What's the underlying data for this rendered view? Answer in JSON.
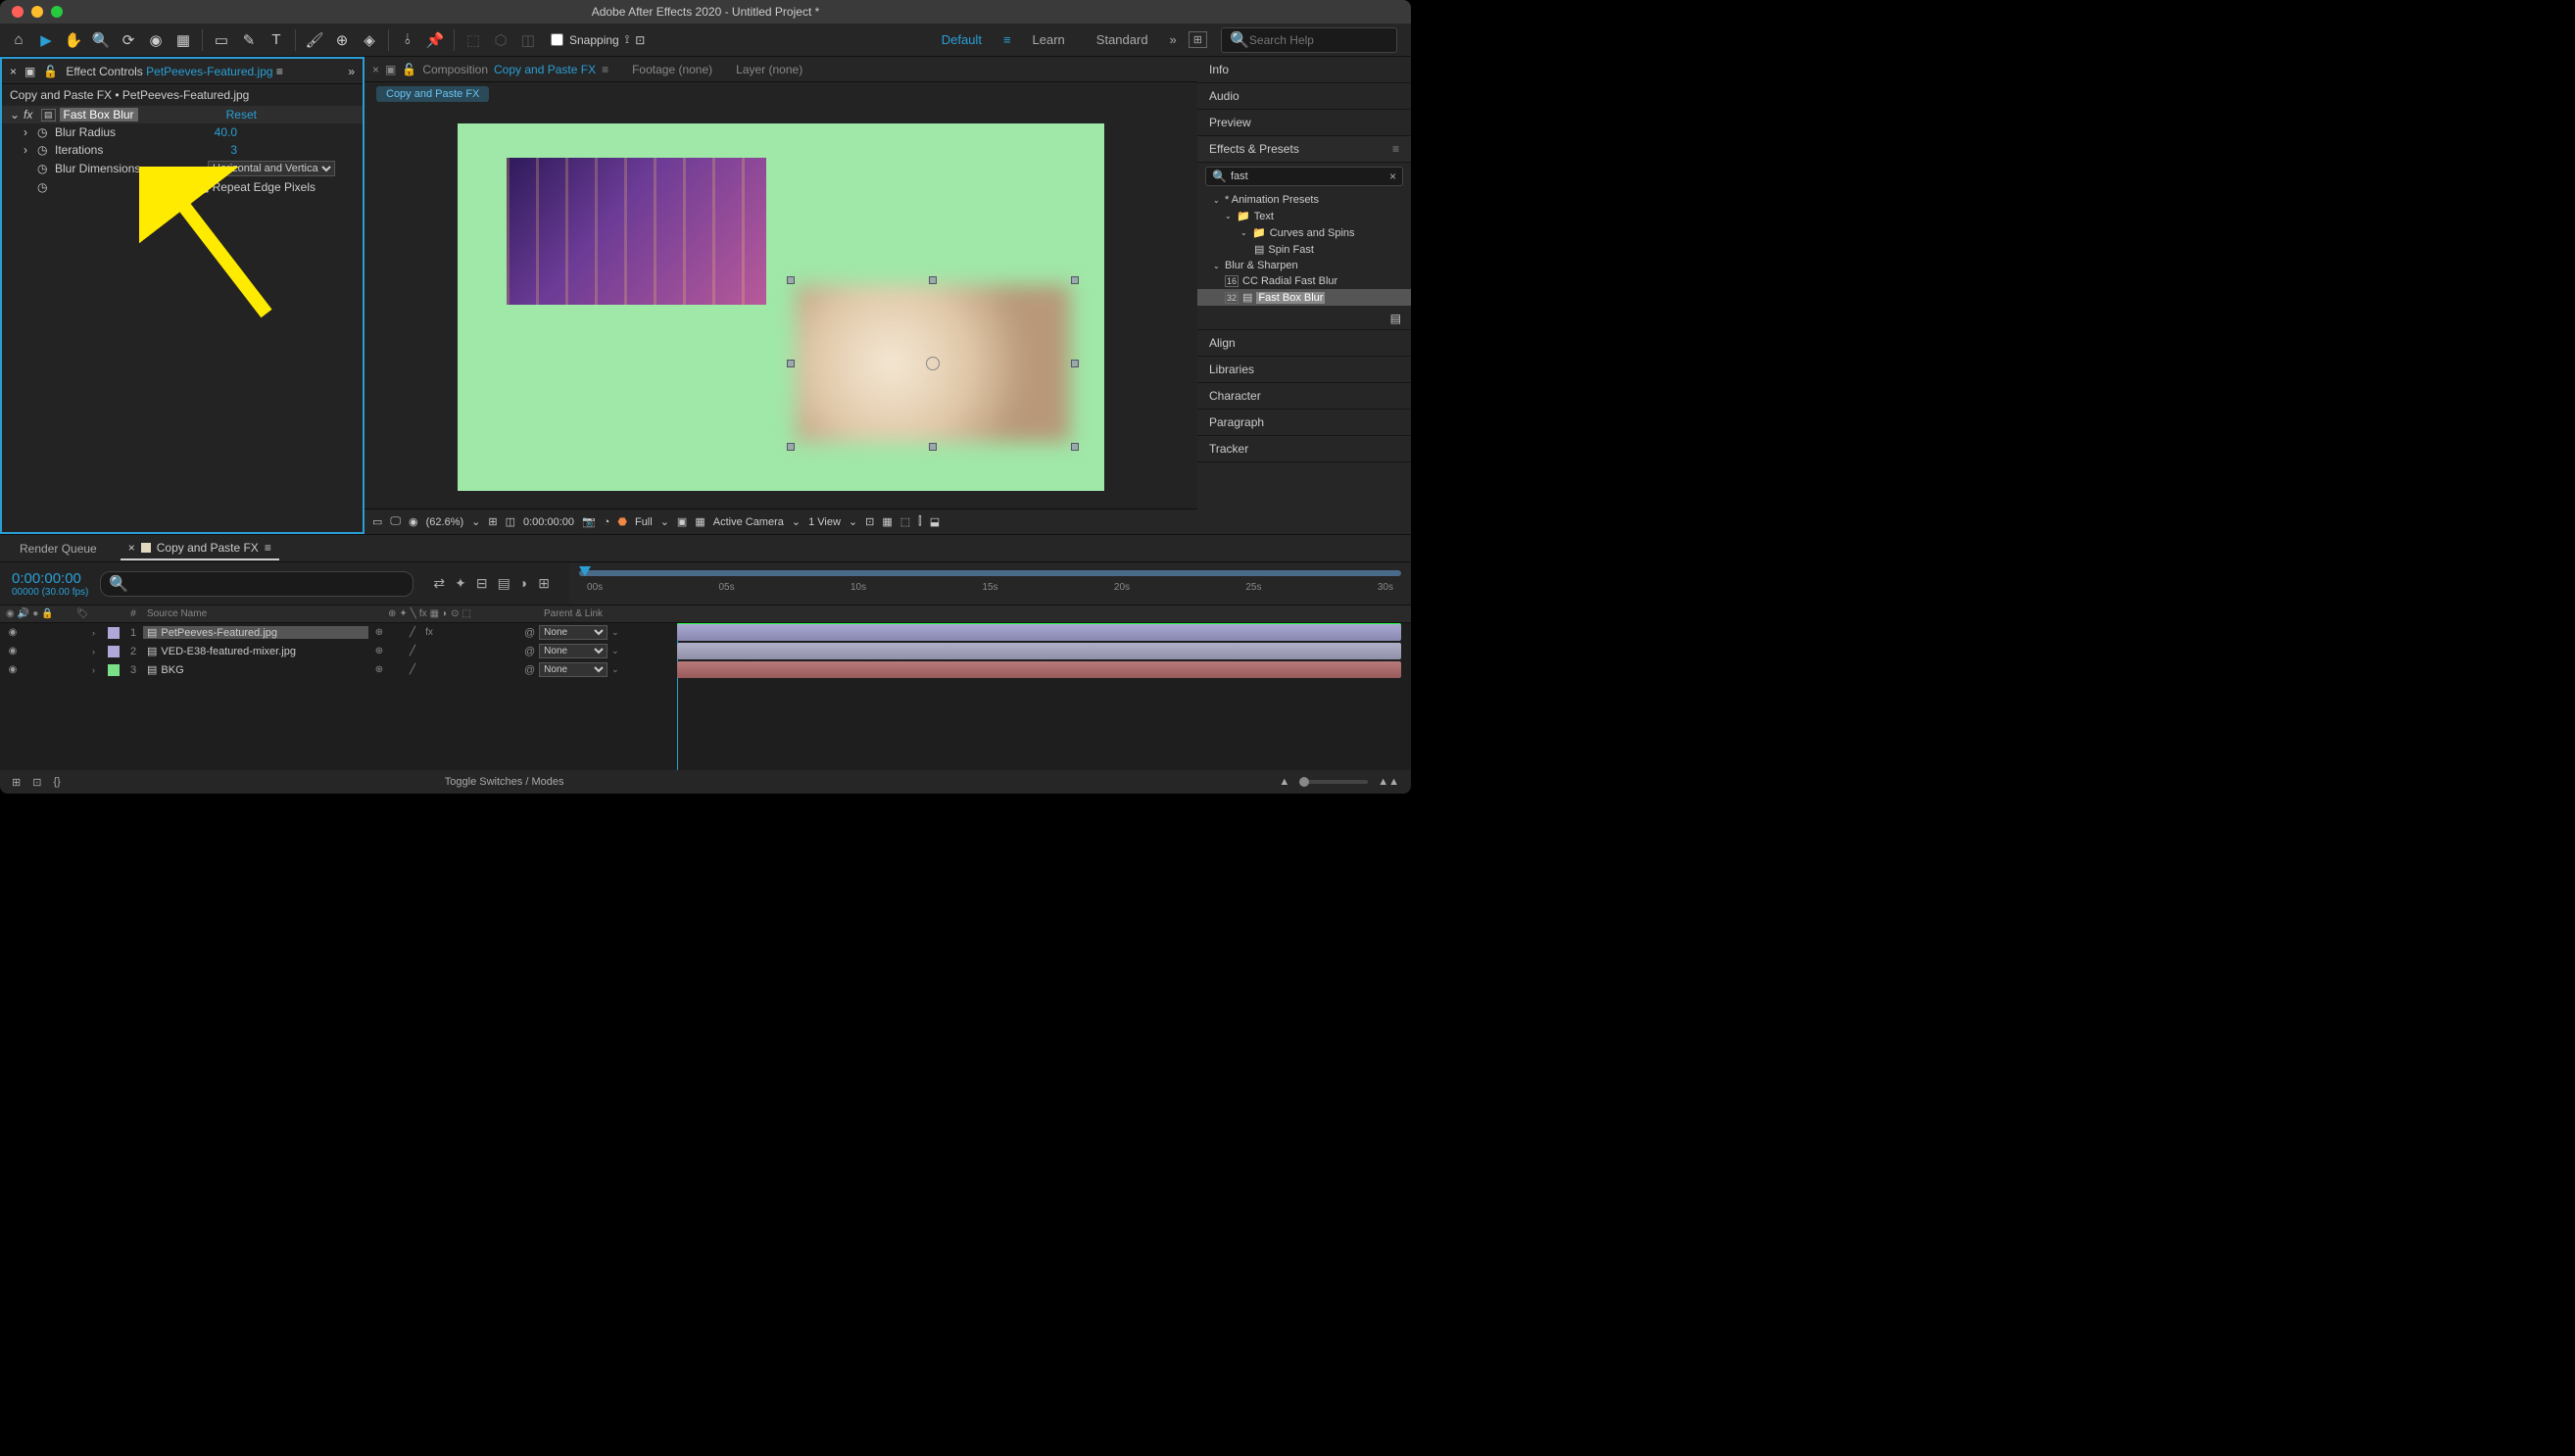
{
  "window": {
    "title": "Adobe After Effects 2020 - Untitled Project *"
  },
  "toolbar": {
    "snapping_label": "Snapping",
    "workspaces": {
      "default": "Default",
      "learn": "Learn",
      "standard": "Standard"
    },
    "search_placeholder": "Search Help"
  },
  "effect_controls": {
    "panel_title_prefix": "Effect Controls ",
    "panel_title_link": "PetPeeves-Featured.jpg",
    "breadcrumb": "Copy and Paste FX • PetPeeves-Featured.jpg",
    "effect_name": "Fast Box Blur",
    "reset_label": "Reset",
    "props": {
      "blur_radius_label": "Blur Radius",
      "blur_radius_value": "40.0",
      "iterations_label": "Iterations",
      "iterations_value": "3",
      "blur_dimensions_label": "Blur Dimensions",
      "blur_dimensions_value": "Horizontal and Vertical",
      "repeat_edge_label": "Repeat Edge Pixels"
    }
  },
  "composition": {
    "panel_prefix": "Composition ",
    "panel_link": "Copy and Paste FX",
    "footage_tab": "Footage (none)",
    "layer_tab": "Layer (none)",
    "subtab": "Copy and Paste FX",
    "controls": {
      "magnification": "(62.6%)",
      "timecode": "0:00:00:00",
      "resolution": "Full",
      "camera": "Active Camera",
      "views": "1 View"
    }
  },
  "right_panel": {
    "info": "Info",
    "audio": "Audio",
    "preview": "Preview",
    "effects_presets": "Effects & Presets",
    "search_value": "fast",
    "tree": {
      "animation_presets": "* Animation Presets",
      "text": "Text",
      "curves_spins": "Curves and Spins",
      "spin_fast": "Spin Fast",
      "blur_sharpen": "Blur & Sharpen",
      "cc_radial": "CC Radial Fast Blur",
      "fast_box_blur": "Fast Box Blur"
    },
    "align": "Align",
    "libraries": "Libraries",
    "character": "Character",
    "paragraph": "Paragraph",
    "tracker": "Tracker"
  },
  "timeline": {
    "render_queue": "Render Queue",
    "comp_tab": "Copy and Paste FX",
    "timecode": "0:00:00:00",
    "timecode_sub": "00000 (30.00 fps)",
    "ruler": [
      "00s",
      "05s",
      "10s",
      "15s",
      "20s",
      "25s",
      "30s"
    ],
    "cols": {
      "num": "#",
      "source": "Source Name",
      "parent": "Parent & Link"
    },
    "layers": [
      {
        "num": "1",
        "name": "PetPeeves-Featured.jpg",
        "color": "#b0a8d8",
        "parent": "None",
        "selected": true,
        "has_fx": true
      },
      {
        "num": "2",
        "name": "VED-E38-featured-mixer.jpg",
        "color": "#b0a8d8",
        "parent": "None",
        "selected": false,
        "has_fx": false
      },
      {
        "num": "3",
        "name": "BKG",
        "color": "#7ae088",
        "parent": "None",
        "selected": false,
        "has_fx": false
      }
    ],
    "toggle_label": "Toggle Switches / Modes"
  }
}
